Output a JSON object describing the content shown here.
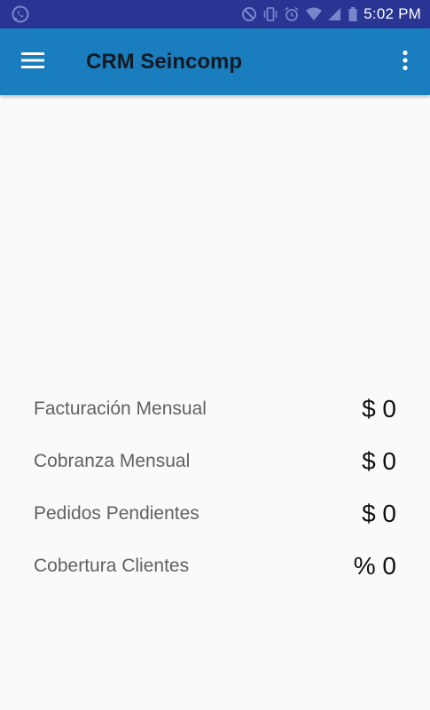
{
  "status_bar": {
    "time": "5:02 PM",
    "icons": [
      "whatsapp-icon",
      "blocked-icon",
      "vibrate-icon",
      "alarm-icon",
      "wifi-icon",
      "signal-icon",
      "battery-icon"
    ]
  },
  "app_bar": {
    "title": "CRM Seincomp",
    "background_color": "#1a7dbd",
    "menu_icon": "hamburger-menu-icon",
    "overflow_icon": "more-vert-icon"
  },
  "summary": {
    "rows": [
      {
        "label": "Facturación Mensual",
        "value": "$ 0"
      },
      {
        "label": "Cobranza Mensual",
        "value": "$ 0"
      },
      {
        "label": "Pedidos Pendientes",
        "value": "$ 0"
      },
      {
        "label": "Cobertura Clientes",
        "value": "% 0"
      }
    ]
  }
}
